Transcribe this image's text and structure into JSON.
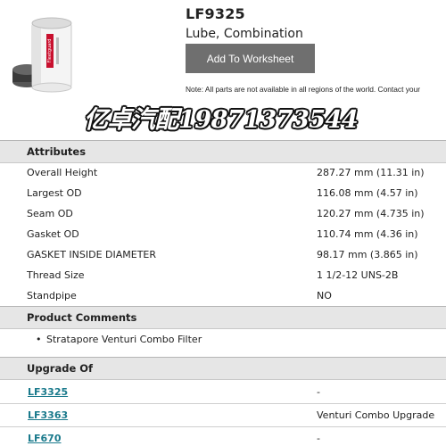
{
  "header": {
    "part_number": "LF9325",
    "description": "Lube, Combination",
    "add_button_label": "Add To Worksheet",
    "note": "Note: All parts are not available in all regions of the world. Contact your"
  },
  "watermark": {
    "text": "亿卓汽配19871373544"
  },
  "product_image": {
    "icon": "oil-filter-image",
    "colors": {
      "body": "#f2f2f2",
      "top": "#dcdcdc",
      "base": "#333333",
      "label_red": "#c8102e"
    },
    "brand_text": "Fleetguard"
  },
  "attributes": {
    "title": "Attributes",
    "rows": [
      {
        "name": "Overall Height",
        "value": "287.27 mm (11.31 in)"
      },
      {
        "name": "Largest OD",
        "value": "116.08 mm (4.57 in)"
      },
      {
        "name": "Seam OD",
        "value": "120.27 mm (4.735 in)"
      },
      {
        "name": "Gasket OD",
        "value": "110.74 mm (4.36 in)"
      },
      {
        "name": "GASKET INSIDE DIAMETER",
        "value": "98.17 mm (3.865 in)"
      },
      {
        "name": "Thread Size",
        "value": "1 1/2-12 UNS-2B"
      },
      {
        "name": "Standpipe",
        "value": "NO"
      }
    ]
  },
  "comments": {
    "title": "Product Comments",
    "items": [
      "Stratapore Venturi Combo Filter"
    ]
  },
  "upgrades": {
    "title": "Upgrade Of",
    "rows": [
      {
        "part": "LF3325",
        "value": "-"
      },
      {
        "part": "LF3363",
        "value": "Venturi Combo Upgrade"
      },
      {
        "part": "LF670",
        "value": "-"
      }
    ]
  },
  "colors": {
    "link": "#1a7a8c",
    "button_bg": "#6f6f6f",
    "header_bg": "#e6e6e6"
  }
}
